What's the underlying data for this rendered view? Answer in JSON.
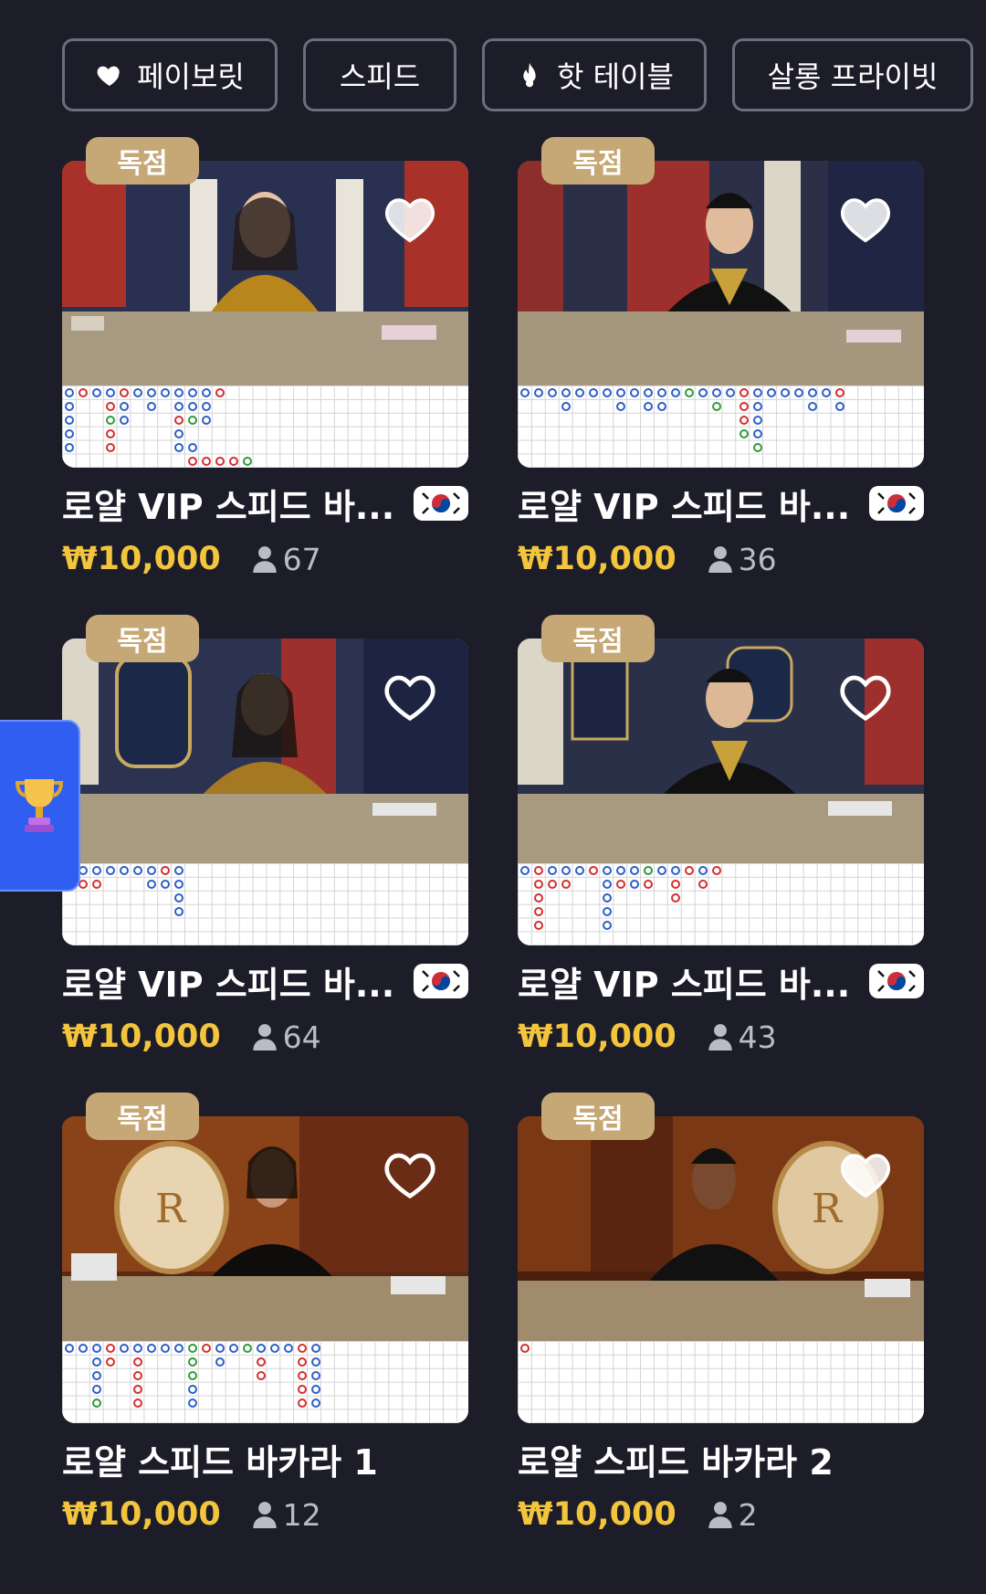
{
  "filters": [
    {
      "label": "페이보릿",
      "icon": "heart-icon"
    },
    {
      "label": "스피드",
      "icon": ""
    },
    {
      "label": "핫 테이블",
      "icon": "flame-icon"
    },
    {
      "label": "살롱 프라이빗",
      "icon": ""
    }
  ],
  "cards": [
    {
      "badge": "독점",
      "title": "로얄 VIP 스피드 바...",
      "price": "₩10,000",
      "players": "67",
      "flag": "korea-flag",
      "favorited": true
    },
    {
      "badge": "독점",
      "title": "로얄 VIP 스피드 바...",
      "price": "₩10,000",
      "players": "36",
      "flag": "korea-flag",
      "favorited": true
    },
    {
      "badge": "독점",
      "title": "로얄 VIP 스피드 바...",
      "price": "₩10,000",
      "players": "64",
      "flag": "korea-flag",
      "favorited": false
    },
    {
      "badge": "독점",
      "title": "로얄 VIP 스피드 바...",
      "price": "₩10,000",
      "players": "43",
      "flag": "korea-flag",
      "favorited": false
    },
    {
      "badge": "독점",
      "title": "로얄 스피드 바카라 1",
      "price": "₩10,000",
      "players": "12",
      "flag": "",
      "favorited": false
    },
    {
      "badge": "독점",
      "title": "로얄 스피드 바카라 2",
      "price": "₩10,000",
      "players": "2",
      "flag": "",
      "favorited": true
    }
  ],
  "side_tab": {
    "icon": "trophy-icon"
  },
  "colors": {
    "background": "#1c1d29",
    "badge": "#c6a877",
    "price": "#f3c53c",
    "player_marker": "#2d5fc8",
    "banker_marker": "#d32f2f",
    "tie_marker": "#2e9b3c"
  }
}
